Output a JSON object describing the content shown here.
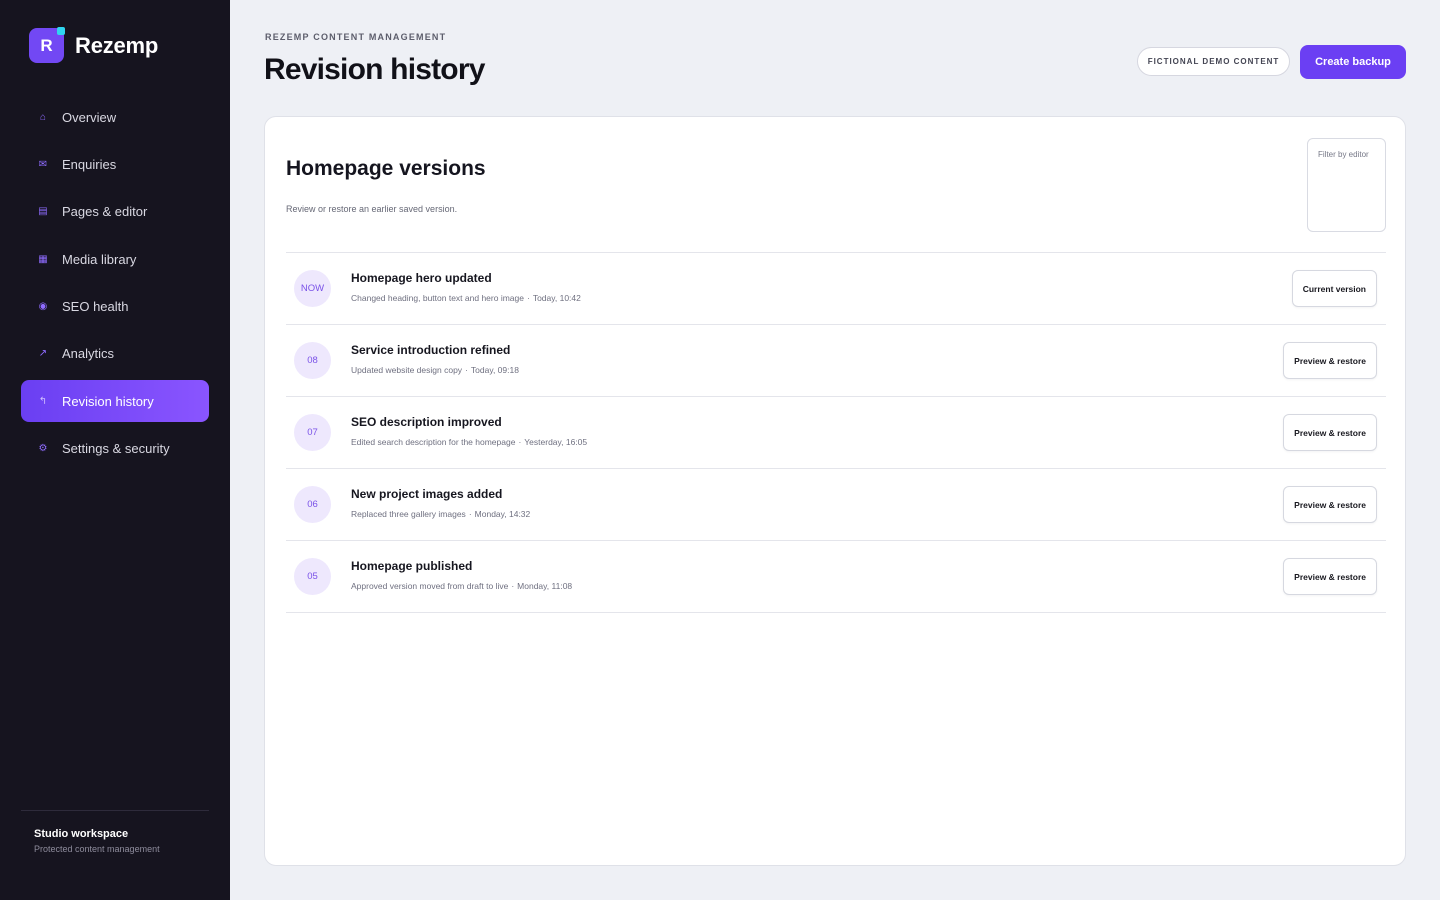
{
  "brand": {
    "initial": "R",
    "name": "Rezemp"
  },
  "sidebar": {
    "items": [
      {
        "label": "Overview",
        "icon": "home-icon",
        "glyph": "⌂"
      },
      {
        "label": "Enquiries",
        "icon": "mail-icon",
        "glyph": "✉"
      },
      {
        "label": "Pages & editor",
        "icon": "page-icon",
        "glyph": "▤"
      },
      {
        "label": "Media library",
        "icon": "image-icon",
        "glyph": "▦"
      },
      {
        "label": "SEO health",
        "icon": "target-icon",
        "glyph": "◉"
      },
      {
        "label": "Analytics",
        "icon": "trend-arrow-icon",
        "glyph": "↗"
      },
      {
        "label": "Revision history",
        "icon": "history-icon",
        "glyph": "↰",
        "active": true
      },
      {
        "label": "Settings & security",
        "icon": "gear-icon",
        "glyph": "⚙"
      }
    ],
    "workspace": {
      "name": "Studio workspace",
      "subtitle": "Protected content management"
    }
  },
  "header": {
    "eyebrow": "REZEMP CONTENT MANAGEMENT",
    "title": "Revision history",
    "demo_pill": "FICTIONAL DEMO CONTENT",
    "backup_label": "Create backup"
  },
  "card": {
    "title": "Homepage versions",
    "subtitle": "Review or restore an earlier saved version.",
    "filter_placeholder": "Filter by editor",
    "versions": [
      {
        "badge": "NOW",
        "title": "Homepage hero updated",
        "description": "Changed heading, button text and hero image",
        "time": "Today, 10:42",
        "action": "Current version"
      },
      {
        "badge": "08",
        "title": "Service introduction refined",
        "description": "Updated website design copy",
        "time": "Today, 09:18",
        "action": "Preview & restore"
      },
      {
        "badge": "07",
        "title": "SEO description improved",
        "description": "Edited search description for the homepage",
        "time": "Yesterday, 16:05",
        "action": "Preview & restore"
      },
      {
        "badge": "06",
        "title": "New project images added",
        "description": "Replaced three gallery images",
        "time": "Monday, 14:32",
        "action": "Preview & restore"
      },
      {
        "badge": "05",
        "title": "Homepage published",
        "description": "Approved version moved from draft to live",
        "time": "Monday, 11:08",
        "action": "Preview & restore"
      }
    ]
  },
  "colors": {
    "sidebar_bg": "#16141f",
    "accent": "#6b3ff3",
    "badge_bg": "#eee8fd",
    "badge_text": "#7a52e8",
    "page_bg": "#eef0f5"
  }
}
